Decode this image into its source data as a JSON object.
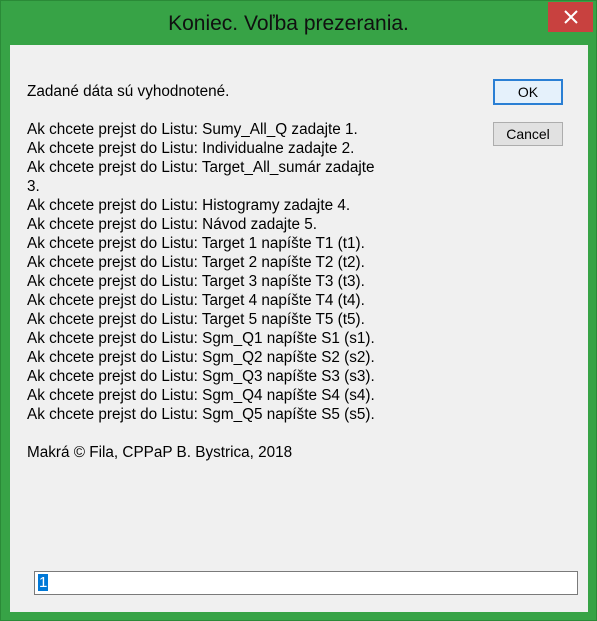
{
  "dialog": {
    "title": "Koniec. Voľba prezerania.",
    "close_symbol": "✕",
    "close_icon": "close-icon",
    "accent_color": "#37a346",
    "message_intro": "Zadané dáta sú vyhodnotené.",
    "message_lines": [
      "Ak chcete prejst do Listu: Sumy_All_Q zadajte 1.",
      "Ak chcete prejst do Listu: Individualne zadajte 2.",
      "Ak chcete prejst do Listu: Target_All_sumár zadajte",
      "3.",
      "Ak chcete prejst do Listu: Histogramy zadajte 4.",
      "Ak chcete prejst do Listu: Návod zadajte 5.",
      "Ak chcete prejst do Listu: Target 1 napíšte T1 (t1).",
      "Ak chcete prejst do Listu: Target 2 napíšte T2 (t2).",
      "Ak chcete prejst do Listu: Target 3 napíšte T3 (t3).",
      "Ak chcete prejst do Listu: Target 4 napíšte T4 (t4).",
      "Ak chcete prejst do Listu: Target 5 napíšte T5 (t5).",
      "Ak chcete prejst do Listu: Sgm_Q1 napíšte S1 (s1).",
      "Ak chcete prejst do Listu: Sgm_Q2 napíšte S2 (s2).",
      "Ak chcete prejst do Listu: Sgm_Q3 napíšte S3 (s3).",
      "Ak chcete prejst do Listu: Sgm_Q4 napíšte S4 (s4).",
      "Ak chcete prejst do Listu: Sgm_Q5 napíšte S5 (s5)."
    ],
    "message_footer": "Makrá © Fila, CPPaP B. Bystrica, 2018",
    "ok_label": "OK",
    "cancel_label": "Cancel",
    "input_value": "1"
  }
}
